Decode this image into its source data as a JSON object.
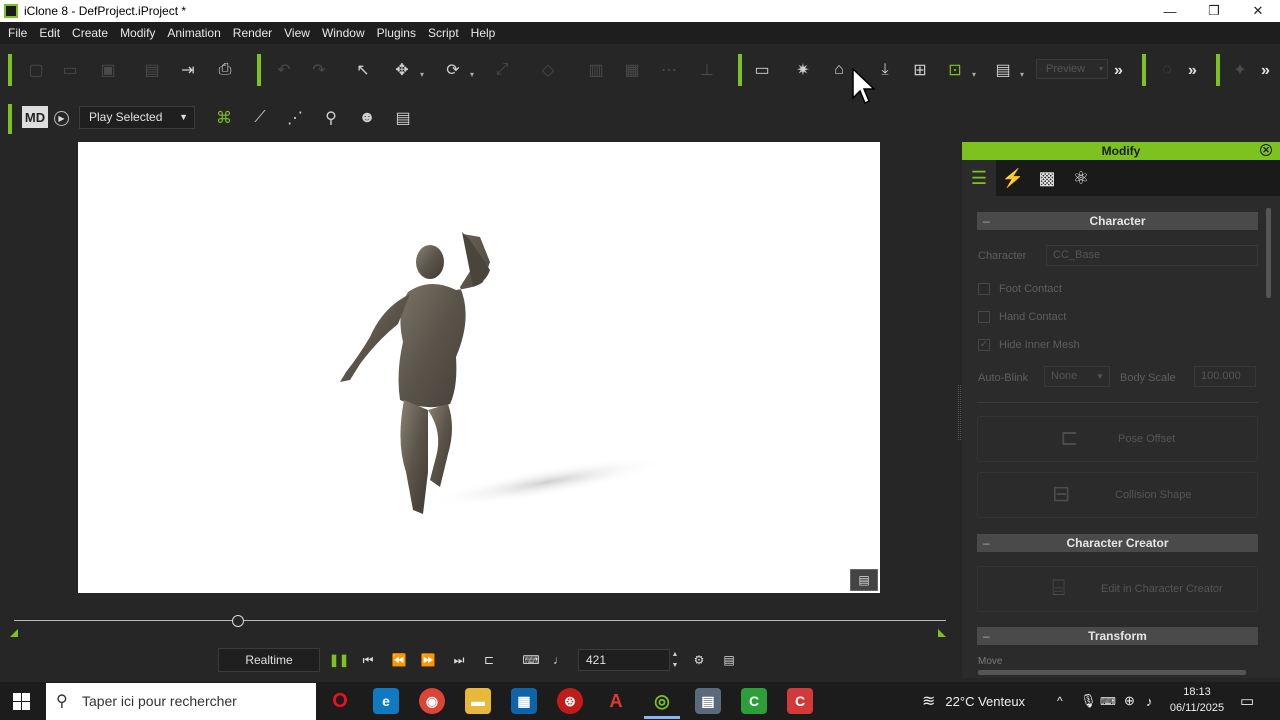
{
  "window": {
    "title": "iClone 8 - DefProject.iProject *",
    "minimize": "—",
    "restore": "❐",
    "close": "✕"
  },
  "menu": [
    "File",
    "Edit",
    "Create",
    "Modify",
    "Animation",
    "Render",
    "View",
    "Window",
    "Plugins",
    "Script",
    "Help"
  ],
  "toolbar": {
    "preview_label": "Preview",
    "more_glyph": "»",
    "play_mode": "Play Selected"
  },
  "modify_panel": {
    "title": "Modify",
    "sections": {
      "character": "Character",
      "character_creator": "Character Creator",
      "transform": "Transform"
    },
    "character_label": "Character",
    "character_value": "CC_Base",
    "foot_contact": "Foot Contact",
    "hand_contact": "Hand Contact",
    "hide_inner_mesh": "Hide Inner Mesh",
    "hide_inner_mesh_checked": true,
    "auto_blink_label": "Auto-Blink",
    "auto_blink_value": "None",
    "body_scale_label": "Body Scale",
    "body_scale_value": "100.000",
    "pose_offset": "Pose Offset",
    "collision_shape": "Collision Shape",
    "edit_in_cc": "Edit in Character Creator",
    "move_label": "Move"
  },
  "playback": {
    "mode": "Realtime",
    "frame": "421",
    "timeline_position": 0.24
  },
  "taskbar": {
    "search_placeholder": "Taper ici pour rechercher",
    "weather": "22°C  Venteux",
    "time": "18:13",
    "date": "06/11/2025"
  },
  "colors": {
    "accent": "#7dc21e",
    "panel_bg": "#2b2b2b",
    "viewport_bg": "#ffffff"
  }
}
